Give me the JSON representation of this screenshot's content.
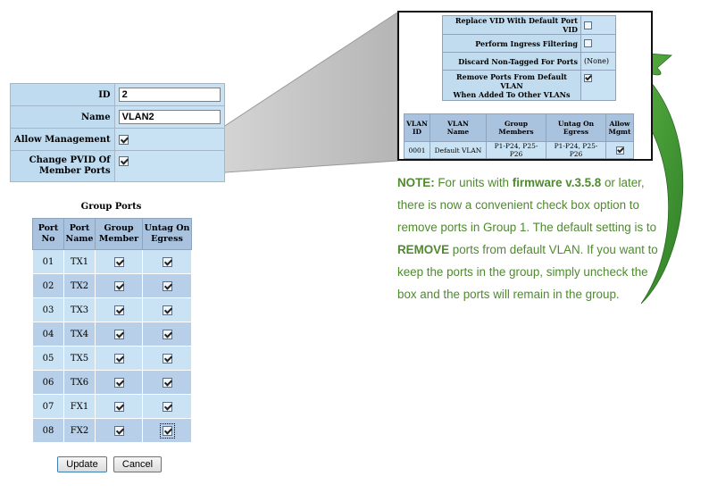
{
  "vlan_form": {
    "id_label": "ID",
    "id_value": "2",
    "name_label": "Name",
    "name_value": "VLAN2",
    "allow_management_label": "Allow Management",
    "allow_management_checked": true,
    "change_pvid_label_line1": "Change PVID Of",
    "change_pvid_label_line2": "Member Ports",
    "change_pvid_checked": true
  },
  "group_ports": {
    "title": "Group Ports",
    "headers": [
      [
        "Port",
        "No"
      ],
      [
        "Port",
        "Name"
      ],
      [
        "Group",
        "Member"
      ],
      [
        "Untag On",
        "Egress"
      ]
    ],
    "rows": [
      {
        "no": "01",
        "name": "TX1",
        "member": true,
        "untag": true
      },
      {
        "no": "02",
        "name": "TX2",
        "member": true,
        "untag": true
      },
      {
        "no": "03",
        "name": "TX3",
        "member": true,
        "untag": true
      },
      {
        "no": "04",
        "name": "TX4",
        "member": true,
        "untag": true
      },
      {
        "no": "05",
        "name": "TX5",
        "member": true,
        "untag": true
      },
      {
        "no": "06",
        "name": "TX6",
        "member": true,
        "untag": true
      },
      {
        "no": "07",
        "name": "FX1",
        "member": true,
        "untag": true
      },
      {
        "no": "08",
        "name": "FX2",
        "member": true,
        "untag": true
      }
    ]
  },
  "buttons": {
    "update": "Update",
    "cancel": "Cancel"
  },
  "callout": {
    "replace_vid_label": "Replace VID With Default Port VID",
    "perform_ingress_label": "Perform Ingress Filtering",
    "discard_label": "Discard Non-Tagged For Ports",
    "discard_value": "(None)",
    "remove_ports_line1": "Remove Ports From Default VLAN",
    "remove_ports_line2": "When Added To Other VLANs",
    "replace_vid_checked": false,
    "perform_ingress_checked": false,
    "remove_ports_checked": true,
    "vlan_list_headers": [
      [
        "VLAN",
        "ID"
      ],
      [
        "VLAN",
        "Name"
      ],
      [
        "Group",
        "Members"
      ],
      [
        "Untag On",
        "Egress"
      ],
      [
        "Allow",
        "Mgmt"
      ]
    ],
    "vlan_list_row": {
      "id": "0001",
      "name": "Default VLAN",
      "members": "P1-P24, P25-P26",
      "untag": "P1-P24, P25-P26",
      "mgmt": true
    }
  },
  "note": {
    "prefix": "NOTE:",
    "t1": " For units with ",
    "firmware": "firmware v.3.5.8",
    "t2": " or later, there is now a convenient check box option to remove ports in Group 1. The default setting is to ",
    "remove": "REMOVE",
    "t3": " ports from default VLAN. If you want to keep the ports in the group, simply uncheck the box and the ports will remain in the group."
  },
  "colors": {
    "note_green": "#4f8a2e",
    "arrow_green": "#3f9a34",
    "row_light": "#c9e3f4",
    "row_dark": "#b7cfe9",
    "header": "#a9c2dd"
  }
}
